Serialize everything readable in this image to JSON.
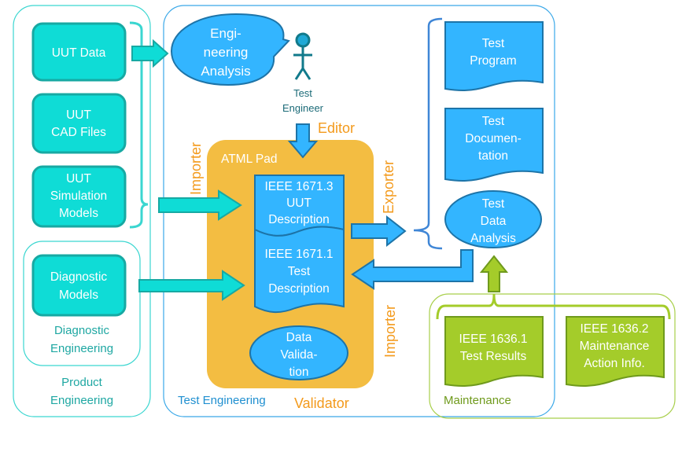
{
  "colors": {
    "teal_fill": "#0fdcd6",
    "teal_stroke": "#17a9a3",
    "blue_fill": "#33b5ff",
    "blue_stroke": "#1d74a8",
    "orange_pad": "#f3bd42",
    "orange_text": "#f39a1c",
    "green_fill": "#a4cc2a",
    "green_stroke": "#6f9a1c",
    "teal_text": "#1ea7a2",
    "blue_text": "#1f8fd0"
  },
  "product_engineering": {
    "label_1": "Product",
    "label_2": "Engineering",
    "uut_data": "UUT Data",
    "uut_cad_1": "UUT",
    "uut_cad_2": "CAD Files",
    "uut_sim_1": "UUT",
    "uut_sim_2": "Simulation",
    "uut_sim_3": "Models",
    "diagnostic_engineering": {
      "label_1": "Diagnostic",
      "label_2": "Engineering",
      "models_1": "Diagnostic",
      "models_2": "Models"
    }
  },
  "test_engineering": {
    "label": "Test Engineering",
    "analysis_1": "Engi-",
    "analysis_2": "neering",
    "analysis_3": "Analysis",
    "engineer_1": "Test",
    "engineer_2": "Engineer",
    "editor": "Editor",
    "importer_left": "Importer",
    "exporter": "Exporter",
    "importer_right": "Importer",
    "validator": "Validator",
    "atml_pad": {
      "title": "ATML Pad",
      "uut_desc_1": "IEEE 1671.3",
      "uut_desc_2": "UUT",
      "uut_desc_3": "Description",
      "test_desc_1": "IEEE 1671.1",
      "test_desc_2": "Test",
      "test_desc_3": "Description",
      "validation_1": "Data",
      "validation_2": "Valida-",
      "validation_3": "tion"
    },
    "outputs": {
      "program_1": "Test",
      "program_2": "Program",
      "doc_1": "Test",
      "doc_2": "Documen-",
      "doc_3": "tation",
      "analysis_1": "Test",
      "analysis_2": "Data",
      "analysis_3": "Analysis"
    }
  },
  "maintenance": {
    "label": "Maintenance",
    "results_1": "IEEE 1636.1",
    "results_2": "Test Results",
    "action_1": "IEEE 1636.2",
    "action_2": "Maintenance",
    "action_3": "Action Info."
  }
}
